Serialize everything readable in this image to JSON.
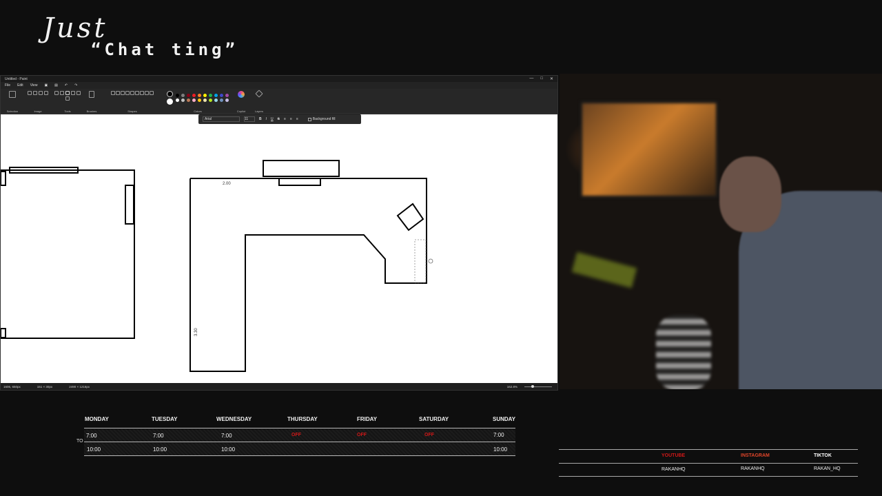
{
  "overlay": {
    "title_script": "Just",
    "title_main": "“Chat ting”"
  },
  "paint": {
    "window_title": "Untitled - Paint",
    "menu": [
      "File",
      "Edit",
      "View"
    ],
    "ribbon_groups": [
      "Selection",
      "Image",
      "Tools",
      "Brushes",
      "Shapes",
      "Colors",
      "Copilot",
      "Layers"
    ],
    "colors": [
      "#000000",
      "#7f7f7f",
      "#880015",
      "#ed1c24",
      "#ff7f27",
      "#fff200",
      "#22b14c",
      "#00a2e8",
      "#3f48cc",
      "#a349a4",
      "#ffffff",
      "#c3c3c3",
      "#b97a57",
      "#ffaec9",
      "#ffc90e",
      "#efe4b0",
      "#b5e61d",
      "#99d9ea",
      "#7092be",
      "#c8bfe7"
    ],
    "textbar": {
      "font": "Arial",
      "size": "11",
      "bold": "B",
      "italic": "I",
      "underline": "U",
      "strike": "S",
      "background_fill": "Background fill"
    },
    "drawing": {
      "label_top": "2.00",
      "label_side": "3.30"
    },
    "status": {
      "cursor": "1606, 650px",
      "selection": "151 × 30px",
      "canvas_size": "2490 × 1216px",
      "zoom": "162.8%"
    }
  },
  "schedule": {
    "to_label": "TO",
    "days": [
      {
        "name": "MONDAY",
        "start": "7:00",
        "end": "10:00",
        "off": false
      },
      {
        "name": "TUESDAY",
        "start": "7:00",
        "end": "10:00",
        "off": false
      },
      {
        "name": "WEDNESDAY",
        "start": "7:00",
        "end": "10:00",
        "off": false
      },
      {
        "name": "THURSDAY",
        "start": "OFF",
        "end": "",
        "off": true
      },
      {
        "name": "FRIDAY",
        "start": "OFF",
        "end": "",
        "off": true
      },
      {
        "name": "SATURDAY",
        "start": "OFF",
        "end": "",
        "off": true
      },
      {
        "name": "SUNDAY",
        "start": "7:00",
        "end": "10:00",
        "off": false
      }
    ]
  },
  "socials": [
    {
      "platform": "YOUTUBE",
      "handle": "RAKANHQ",
      "color": "#d01818"
    },
    {
      "platform": "INSTAGRAM",
      "handle": "RAKANHQ",
      "color": "#e0452a"
    },
    {
      "platform": "TIKTOK",
      "handle": "RAKAN_HQ",
      "color": "#ffffff"
    }
  ]
}
